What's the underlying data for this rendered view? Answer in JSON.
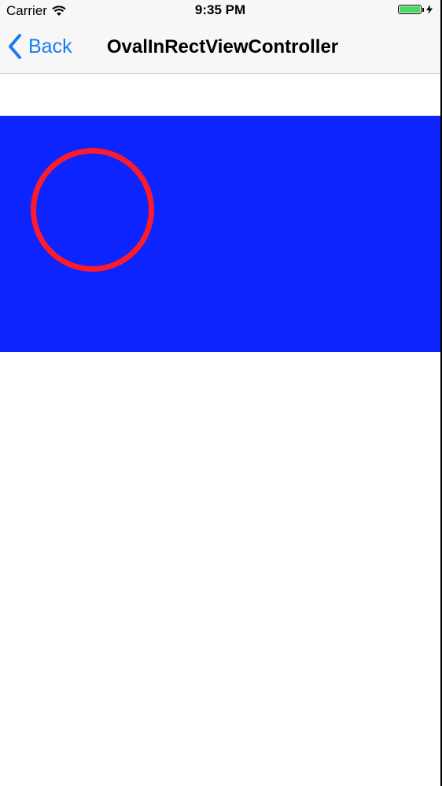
{
  "status_bar": {
    "carrier": "Carrier",
    "time": "9:35 PM",
    "battery_level": 1.0,
    "charging": true
  },
  "nav_bar": {
    "back_label": "Back",
    "title": "OvalInRectViewController"
  },
  "colors": {
    "accent": "#1a7cf5",
    "rect_fill": "#0d24ff",
    "oval_stroke": "#ff1a2a",
    "battery_fill": "#4cd964"
  }
}
